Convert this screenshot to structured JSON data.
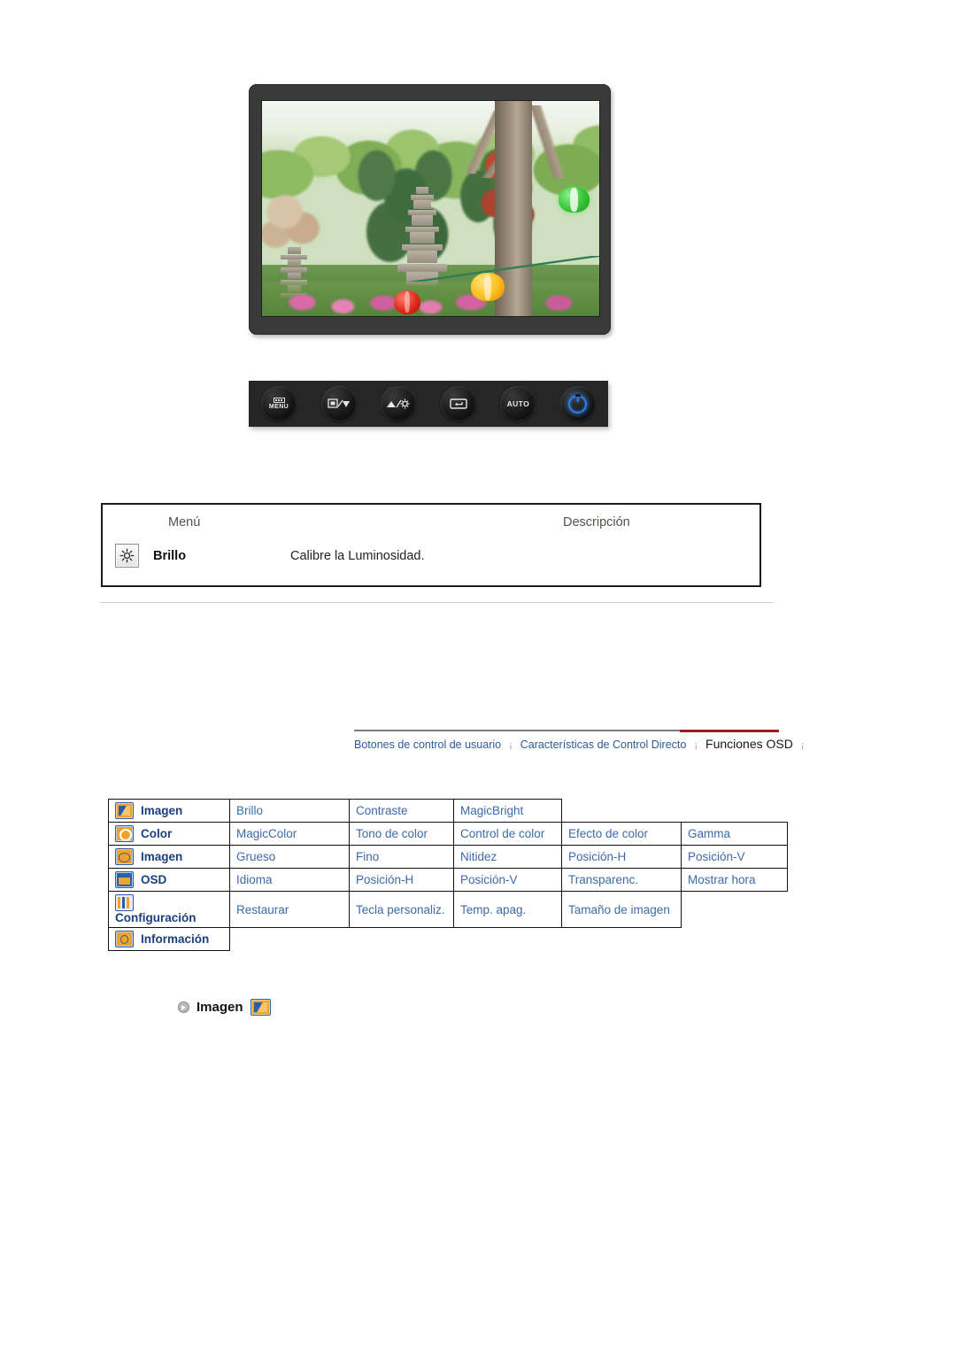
{
  "monitor_figure": {
    "alt": "Monitor mostrando una fotografia de un jardin con pagoda de piedra y faroles",
    "scene_elements": [
      "arboles",
      "pagoda-de-piedra",
      "farol-verde",
      "farol-amarillo",
      "farol-rojo",
      "flores"
    ]
  },
  "control_bar": {
    "buttons": [
      {
        "name": "menu-button",
        "label": "MENU",
        "icon": "menu-bars-icon"
      },
      {
        "name": "source-down-button",
        "label": "",
        "icon": "source-down-icon"
      },
      {
        "name": "brightness-up-button",
        "label": "",
        "icon": "brightness-up-icon"
      },
      {
        "name": "enter-button",
        "label": "",
        "icon": "enter-icon"
      },
      {
        "name": "auto-button",
        "label": "AUTO",
        "icon": "auto-icon"
      },
      {
        "name": "power-button",
        "label": "",
        "icon": "power-icon"
      }
    ]
  },
  "description_table": {
    "headers": {
      "menu": "Menú",
      "description": "Descripción"
    },
    "rows": [
      {
        "icon": "brightness-icon",
        "menu": "Brillo",
        "description": "Calibre la Luminosidad."
      }
    ]
  },
  "breadcrumb": {
    "items": [
      {
        "label": "Botones de control de usuario",
        "current": false
      },
      {
        "label": "Características de Control Directo",
        "current": false
      },
      {
        "label": "Funciones OSD",
        "current": true
      }
    ],
    "separator": "¡",
    "accent_color": "#9e1b21",
    "link_color": "#2a5c9c"
  },
  "osd_menu_table": {
    "rows": [
      {
        "icon": "image-icon",
        "category": "Imagen",
        "items": [
          "Brillo",
          "Contraste",
          "MagicBright"
        ]
      },
      {
        "icon": "color-icon",
        "category": "Color",
        "items": [
          "MagicColor",
          "Tono de color",
          "Control de color",
          "Efecto de color",
          "Gamma"
        ]
      },
      {
        "icon": "geometry-icon",
        "category": "Imagen",
        "items": [
          "Grueso",
          "Fino",
          "Nitidez",
          "Posición-H",
          "Posición-V"
        ]
      },
      {
        "icon": "osd-icon",
        "category": "OSD",
        "items": [
          "Idioma",
          "Posición-H",
          "Posición-V",
          "Transparenc.",
          "Mostrar hora"
        ]
      },
      {
        "icon": "setup-icon",
        "category": "Configuración",
        "items": [
          "Restaurar",
          "Tecla personaliz.",
          "Temp. apag.",
          "Tamaño de imagen"
        ]
      },
      {
        "icon": "information-icon",
        "category": "Información",
        "items": []
      }
    ]
  },
  "section_heading": {
    "bullet": "arrow-bullet-icon",
    "title": "Imagen",
    "icon": "image-icon"
  }
}
